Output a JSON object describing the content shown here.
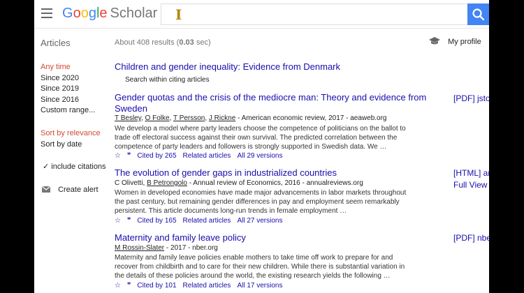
{
  "header": {
    "logo_google": "Google",
    "logo_scholar": "Scholar",
    "search_value": ""
  },
  "sidebar": {
    "heading": "Articles",
    "time_filters": [
      "Any time",
      "Since 2020",
      "Since 2019",
      "Since 2016",
      "Custom range..."
    ],
    "sort_options": [
      "Sort by relevance",
      "Sort by date"
    ],
    "citations_label": "include citations",
    "alert_label": "Create alert"
  },
  "stats": {
    "prefix": "About 408 results (",
    "time": "0.03",
    "suffix": " sec)"
  },
  "profile_label": "My profile",
  "featured": {
    "title": "Children and gender inequality: Evidence from Denmark",
    "search_within": "Search within citing articles"
  },
  "results": [
    {
      "title": "Gender quotas and the crisis of the mediocre man: Theory and evidence from Sweden",
      "authors_linked": [
        "T Besley",
        "O Folke",
        "T Persson",
        "J Rickne"
      ],
      "source": " - American economic review, 2017 - aeaweb.org",
      "snippet": "We develop a model where party leaders choose the competence of politicians on the ballot to trade off electoral success against their own survival. The predicted correlation between the competence of party leaders and followers is strongly supported in Swedish data. We …",
      "cited_by": "Cited by 265",
      "related": "Related articles",
      "versions": "All 29 versions",
      "side_label": "[PDF] jsto",
      "side_extra": ""
    },
    {
      "title": "The evolution of gender gaps in industrialized countries",
      "authors_text": "C Olivetti, ",
      "authors_linked": [
        "B Petrongolo"
      ],
      "source": " - Annual review of Economics, 2016 - annualreviews.org",
      "snippet": "Women in developed economies have made major advancements in labor markets throughout the past century, but remaining gender differences in pay and employment seem remarkably persistent. This article documents long-run trends in female employment …",
      "cited_by": "Cited by 165",
      "related": "Related articles",
      "versions": "All 27 versions",
      "side_label": "[HTML] an",
      "side_extra": "Full View"
    },
    {
      "title": "Maternity and family leave policy",
      "authors_linked": [
        "M Rossin-Slater"
      ],
      "source": " - 2017 - nber.org",
      "snippet": "Maternity and family leave policies enable mothers to take time off work to prepare for and recover from childbirth and to care for their new children. While there is substantial variation in the details of these policies around the world, the existing research yields the following …",
      "cited_by": "Cited by 101",
      "related": "Related articles",
      "versions": "All 17 versions",
      "side_label": "[PDF] nbe",
      "side_extra": ""
    }
  ],
  "icons": {
    "star": "☆",
    "quote": "❞",
    "check": "✓"
  },
  "colors": {
    "link": "#1a0dab",
    "active_filter": "#d14836",
    "search_button": "#4285f4"
  }
}
